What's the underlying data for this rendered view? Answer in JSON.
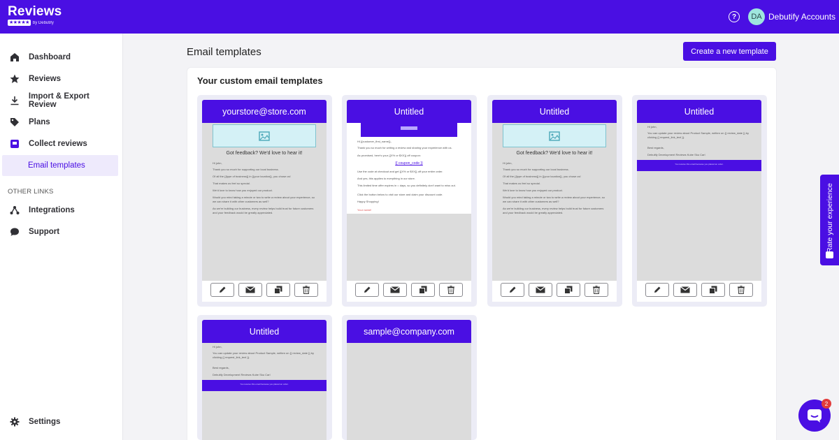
{
  "app": {
    "logo": "Reviews",
    "logo_sub": "by Debutify",
    "stars": "★★★★★"
  },
  "header": {
    "help_icon": "question-circle-icon",
    "avatar_initials": "DA",
    "account_name": "Debutify Accounts"
  },
  "sidebar": {
    "items": [
      {
        "label": "Dashboard",
        "icon": "home-icon"
      },
      {
        "label": "Reviews",
        "icon": "star-icon"
      },
      {
        "label": "Import & Export Review",
        "icon": "download-icon"
      },
      {
        "label": "Plans",
        "icon": "tag-icon"
      },
      {
        "label": "Collect reviews",
        "icon": "collect-icon"
      },
      {
        "label": "Email templates",
        "icon": ""
      }
    ],
    "other_links_heading": "OTHER LINKS",
    "other_items": [
      {
        "label": "Integrations",
        "icon": "integrations-icon"
      },
      {
        "label": "Support",
        "icon": "chat-bubble-icon"
      }
    ],
    "settings_label": "Settings"
  },
  "main": {
    "title": "Email templates",
    "create_button": "Create a new template",
    "section_title": "Your custom email templates",
    "templates": [
      {
        "name": "yourstore@store.com",
        "preview": "feedback"
      },
      {
        "name": "Untitled",
        "preview": "coupon"
      },
      {
        "name": "Untitled",
        "preview": "feedback"
      },
      {
        "name": "Untitled",
        "preview": "update"
      },
      {
        "name": "Untitled",
        "preview": "update"
      },
      {
        "name": "sample@company.com",
        "preview": "empty"
      }
    ],
    "preview_texts": {
      "feedback_heading": "Got feedback? We'd love to hear it!",
      "greeting": "Hi john,",
      "thanks": "Thank you so much for supporting our local business.",
      "of_all": "Of all the {{type of business}} in {{your location}}, you chose us!",
      "special": "That makes us feel so special.",
      "love_know": "We'd love to know how you enjoyed our product.",
      "would_you": "Would you mind taking a minute or two to write a review about your experience, so we can share it with other customers as well?",
      "as_we": "As we're building our business, every review helps build trust for future customers and your feedback would be greatly appreciated.",
      "coupon_hi": "Hi {{customer_first_name}},",
      "coupon_thanks": "Thank you so much for writing a review and sharing your experience with us.",
      "coupon_promised": "As promised, here's your {{X% or $XX}} off coupon:",
      "coupon_code": "{{ coupon_code }}",
      "coupon_use": "Use the code at checkout and get {{X% or $XX}} off your entire order.",
      "coupon_applies": "And yes, this applies to everything in our store.",
      "coupon_expires": "This limited time offer expires in = days, so you definitely don't want to miss out.",
      "coupon_click": "Click the button below to visit our store and claim your discount code.",
      "coupon_happy": "Happy Shopping!",
      "coupon_sign": "Your name!",
      "update_hi": "Hi john,",
      "update_body": "You can update your review about Product Sample, written on {{ review_date }} by clicking {{ request_link_text }}.",
      "update_regards": "Best regards,",
      "update_team": "Debutify Development Reviews Kube Sku Carl",
      "band_text": "You receive this email because you placed an order.",
      "band_sub": "store"
    }
  },
  "actions": {
    "edit_icon": "pencil-icon",
    "email_icon": "envelope-icon",
    "duplicate_icon": "copy-icon",
    "delete_icon": "trash-icon"
  },
  "rate_tab": {
    "label": "Rate your experience"
  },
  "chat": {
    "badge": "2"
  },
  "colors": {
    "brand": "#4a0fe3",
    "preview_bg": "#dcdcdc",
    "card_bg": "#ececf6"
  }
}
